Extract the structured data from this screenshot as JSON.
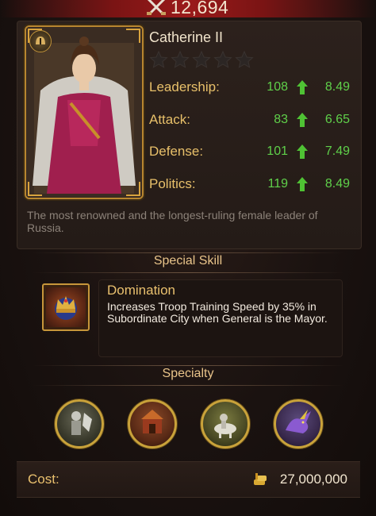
{
  "header": {
    "power_value": "12,694",
    "power_icon": "crossed-swords-icon"
  },
  "general": {
    "name": "Catherine II",
    "stars_total": 5,
    "stars_filled": 0,
    "stats": [
      {
        "label": "Leadership:",
        "base": "108",
        "growth": "8.49"
      },
      {
        "label": "Attack:",
        "base": "83",
        "growth": "6.65"
      },
      {
        "label": "Defense:",
        "base": "101",
        "growth": "7.49"
      },
      {
        "label": "Politics:",
        "base": "119",
        "growth": "8.49"
      }
    ],
    "description": "The most renowned and the longest-ruling female leader of Russia."
  },
  "special_skill": {
    "header": "Special Skill",
    "name": "Domination",
    "description": "Increases Troop Training Speed by 35% in Subordinate City when General is the Mayor.",
    "icon": "crown-icon"
  },
  "specialty": {
    "header": "Specialty",
    "items": [
      {
        "icon": "infantry-icon"
      },
      {
        "icon": "siege-icon"
      },
      {
        "icon": "cavalry-icon"
      },
      {
        "icon": "dragon-icon"
      }
    ]
  },
  "cost": {
    "label": "Cost:",
    "value": "27,000,000",
    "icon": "gold-coin-icon"
  },
  "colors": {
    "stat_label": "#e8c06a",
    "stat_value": "#5fd04a",
    "frame_gold": "#c9a23a",
    "power_bar": "#9a1a1a"
  }
}
